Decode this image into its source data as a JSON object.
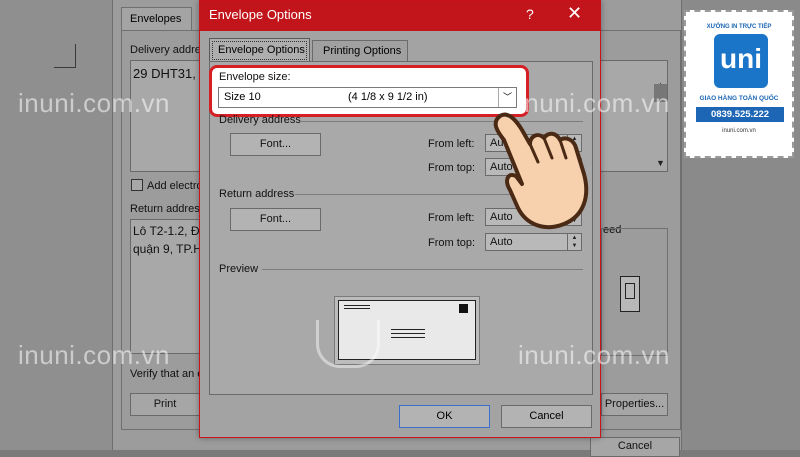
{
  "background": {
    "envelopes_tab": "Envelopes",
    "delivery_label": "Delivery addre",
    "delivery_text": "29 DHT31,",
    "add_electronic_label": "Add electro",
    "return_label": "Return address",
    "return_line1": "Lô T2-1.2, Đ",
    "return_line2": "quận 9, TP.H",
    "feed_label": "eed",
    "verify_text": "Verify that an e",
    "print_button": "Print",
    "properties_button": "Properties...",
    "cancel_button": "Cancel"
  },
  "dialog": {
    "title": "Envelope Options",
    "help": "?",
    "close": "✕",
    "tabs": [
      {
        "label": "Envelope Options",
        "active": true
      },
      {
        "label": "Printing Options",
        "active": false
      }
    ],
    "envelope_size_label": "Envelope size:",
    "envelope_size_name": "Size 10",
    "envelope_size_dims": "(4 1/8 x 9 1/2 in)",
    "delivery_address": {
      "heading": "Delivery address",
      "font_button": "Font...",
      "from_left_label": "From left:",
      "from_left_value": "Auto",
      "from_top_label": "From top:",
      "from_top_value": "Auto"
    },
    "return_address": {
      "heading": "Return address",
      "font_button": "Font...",
      "from_left_label": "From left:",
      "from_left_value": "Auto",
      "from_top_label": "From top:",
      "from_top_value": "Auto"
    },
    "preview_label": "Preview",
    "ok_button": "OK",
    "cancel_button": "Cancel"
  },
  "watermark": "inuni.com.vn",
  "logo": {
    "top_text": "XƯỞNG IN TRỰC TIẾP",
    "mark": "uni",
    "subtitle": "GIAO HÀNG TOÀN QUỐC",
    "phone": "0839.525.222",
    "site": "inuni.com.vn"
  },
  "colors": {
    "titlebar": "#c1151b",
    "highlight": "#d42025",
    "brand_blue": "#1a75c8"
  }
}
